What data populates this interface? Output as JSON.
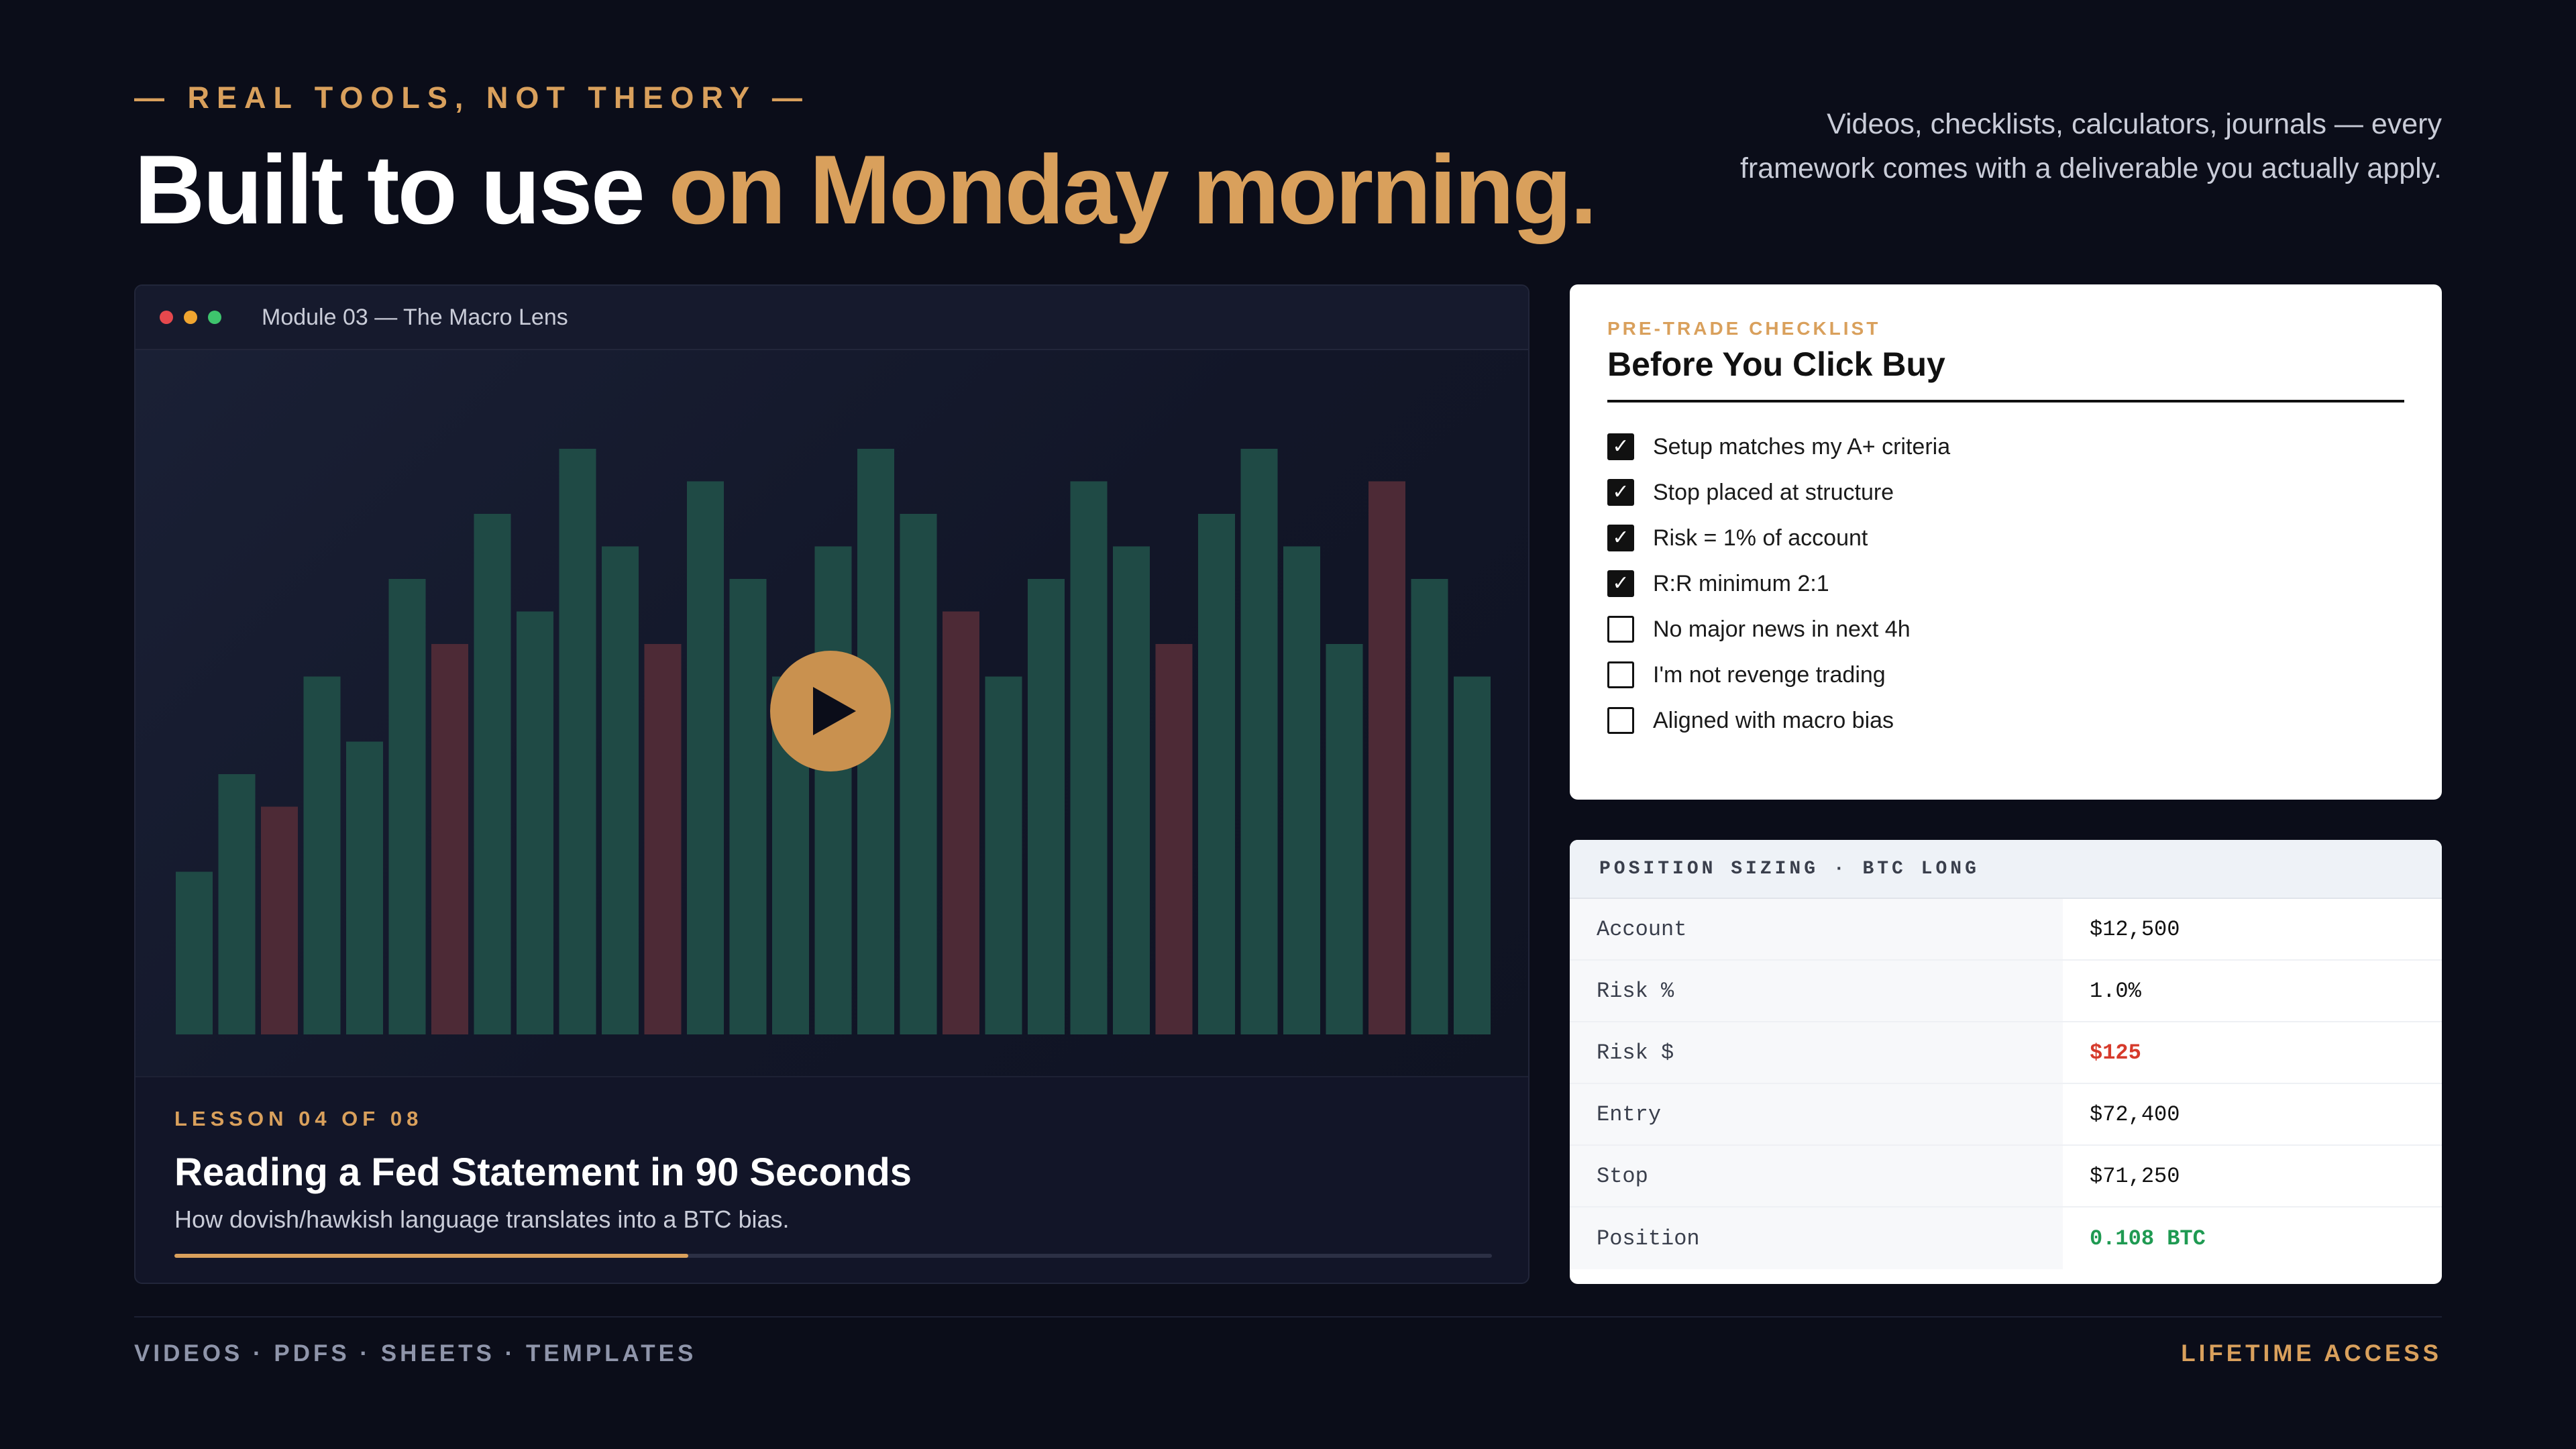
{
  "header": {
    "eyebrow": "— REAL TOOLS, NOT THEORY —",
    "headline_main": "Built to use ",
    "headline_accent": "on Monday morning.",
    "intro": "Videos, checklists, calculators, journals — every framework comes with a deliverable you actually apply."
  },
  "video": {
    "window_title": "Module 03 — The Macro Lens",
    "lesson_eyebrow": "LESSON 04 OF 08",
    "lesson_title": "Reading a Fed Statement in 90 Seconds",
    "lesson_subtitle": "How dovish/hawkish language translates into a BTC bias.",
    "progress": 0.39,
    "play_icon": "play-icon",
    "window_dots": [
      "#e5484d",
      "#f0a530",
      "#3ec46d"
    ],
    "bar_colors": {
      "up": "#1f4a45",
      "down": "#4d2a36"
    },
    "chart_data": {
      "type": "bar",
      "values": [
        25,
        40,
        35,
        55,
        45,
        70,
        60,
        80,
        65,
        90,
        75,
        60,
        85,
        70,
        55,
        75,
        90,
        80,
        65,
        55,
        70,
        85,
        75,
        60,
        80,
        90,
        75,
        60,
        85,
        70,
        55
      ],
      "directions": [
        "up",
        "up",
        "down",
        "up",
        "up",
        "up",
        "down",
        "up",
        "up",
        "up",
        "up",
        "down",
        "up",
        "up",
        "up",
        "up",
        "up",
        "up",
        "down",
        "up",
        "up",
        "up",
        "up",
        "down",
        "up",
        "up",
        "up",
        "up",
        "down",
        "up",
        "up"
      ],
      "ylim": [
        0,
        100
      ]
    }
  },
  "checklist": {
    "eyebrow": "PRE-TRADE CHECKLIST",
    "title": "Before You Click Buy",
    "items": [
      {
        "label": "Setup matches my A+ criteria",
        "checked": true
      },
      {
        "label": "Stop placed at structure",
        "checked": true
      },
      {
        "label": "Risk = 1% of account",
        "checked": true
      },
      {
        "label": "R:R minimum 2:1",
        "checked": true
      },
      {
        "label": "No major news in next 4h",
        "checked": false
      },
      {
        "label": "I'm not revenge trading",
        "checked": false
      },
      {
        "label": "Aligned with macro bias",
        "checked": false
      }
    ]
  },
  "sizing": {
    "title": "POSITION SIZING · BTC LONG",
    "rows": [
      {
        "label": "Account",
        "value": "$12,500",
        "tone": "normal"
      },
      {
        "label": "Risk %",
        "value": "1.0%",
        "tone": "normal"
      },
      {
        "label": "Risk $",
        "value": "$125",
        "tone": "neg"
      },
      {
        "label": "Entry",
        "value": "$72,400",
        "tone": "normal"
      },
      {
        "label": "Stop",
        "value": "$71,250",
        "tone": "normal"
      },
      {
        "label": "Position",
        "value": "0.108 BTC",
        "tone": "pos"
      }
    ]
  },
  "footer": {
    "left": "VIDEOS · PDFS · SHEETS · TEMPLATES",
    "right": "LIFETIME ACCESS"
  }
}
